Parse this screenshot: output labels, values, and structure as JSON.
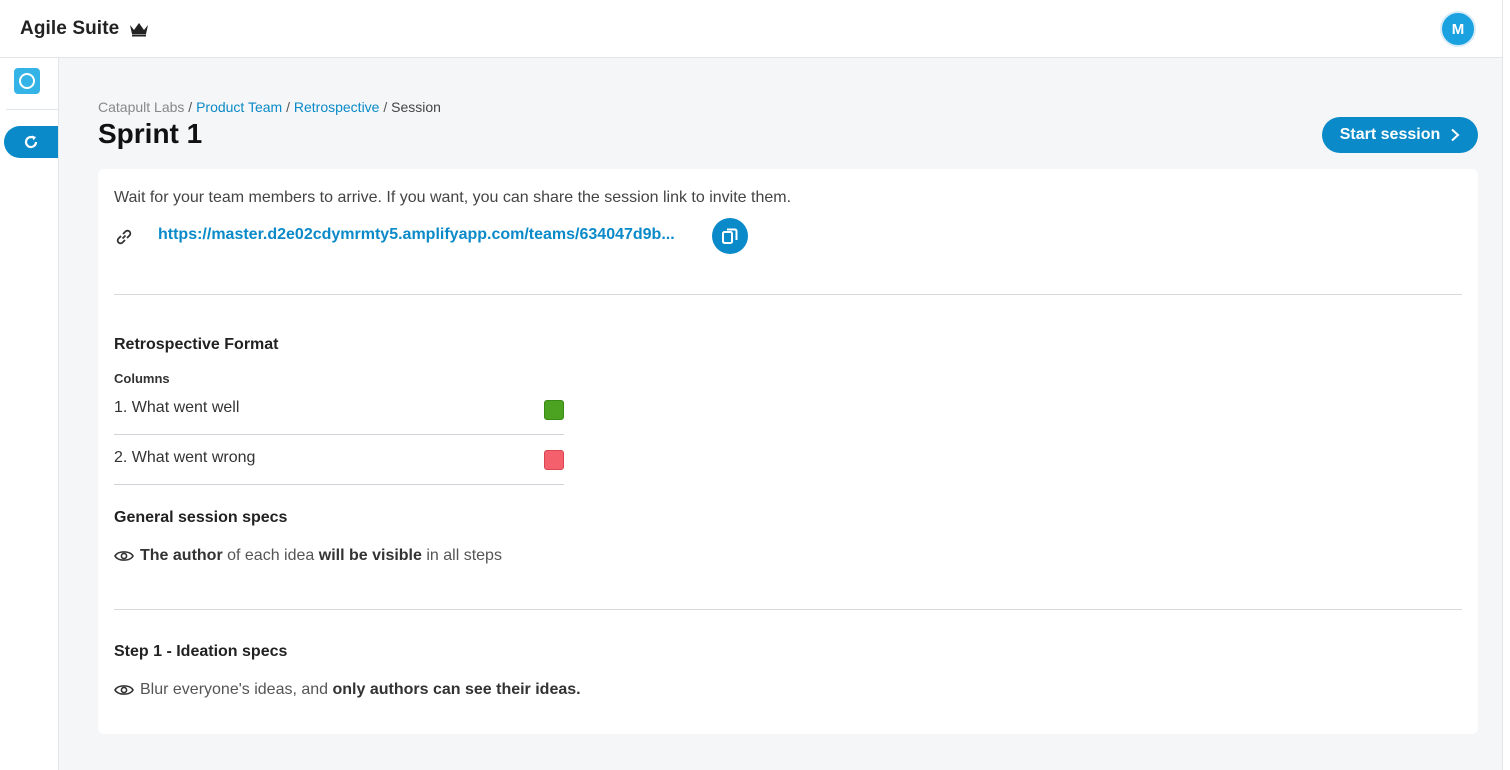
{
  "header": {
    "brand": "Agile Suite",
    "avatar_initial": "M"
  },
  "breadcrumb": {
    "org": "Catapult Labs",
    "team": "Product Team",
    "section": "Retrospective",
    "current": "Session",
    "separator": "/"
  },
  "page": {
    "title": "Sprint 1",
    "start_button": "Start session"
  },
  "invite": {
    "message": "Wait for your team members to arrive. If you want, you can share the session link to invite them.",
    "link": "https://master.d2e02cdymrmty5.amplifyapp.com/teams/634047d9b..."
  },
  "format": {
    "title": "Retrospective Format",
    "columns_label": "Columns",
    "columns": [
      {
        "label": "1. What went well",
        "color": "#4ca321"
      },
      {
        "label": "2. What went wrong",
        "color": "#f5606d"
      }
    ]
  },
  "general": {
    "title": "General session specs",
    "spec": {
      "p1": "The author",
      "p2": " of each idea ",
      "p3": "will be visible",
      "p4": " in all steps"
    }
  },
  "step1": {
    "title": "Step 1 - Ideation specs",
    "spec": {
      "p1": "Blur everyone's ideas, and ",
      "p2": "only authors can see their ideas."
    }
  },
  "colors": {
    "accent": "#0a8ac8",
    "avatar": "#1aa1e0"
  }
}
